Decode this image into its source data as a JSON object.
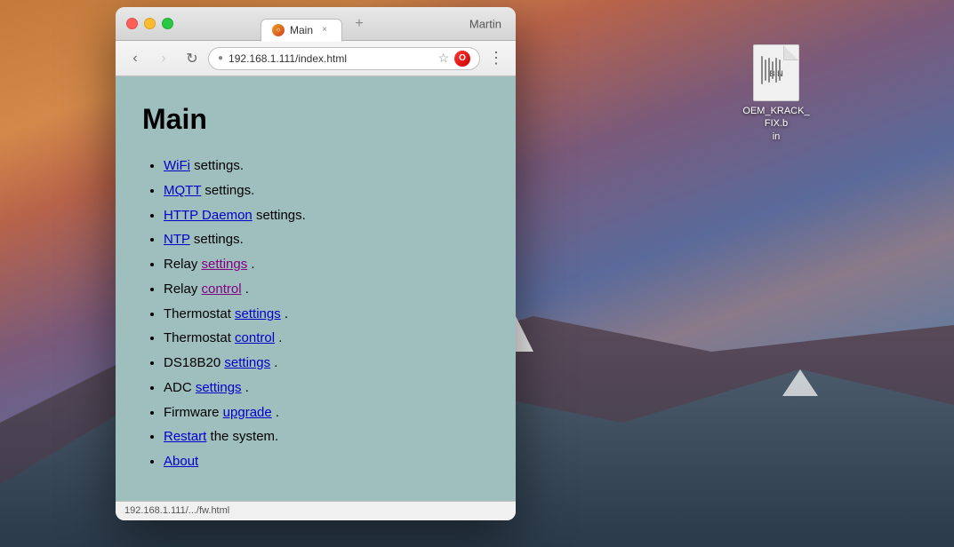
{
  "desktop": {
    "background_description": "macOS desktop with mountain sunset",
    "file_icon": {
      "name": "OEM_KRACK_FIX.b",
      "subtitle": "in",
      "label": "BIN"
    }
  },
  "browser": {
    "title_bar": {
      "tab_title": "Main",
      "tab_favicon": "○",
      "user_name": "Martin",
      "close_label": "×",
      "new_tab_label": "+"
    },
    "nav_bar": {
      "back_label": "‹",
      "forward_label": "›",
      "reload_label": "↻",
      "address": "192.168.1.111/index.html",
      "star_label": "★",
      "more_label": "⋮"
    },
    "page": {
      "title": "Main",
      "menu_items": [
        {
          "link": "WiFi",
          "suffix": " settings."
        },
        {
          "link": "MQTT",
          "suffix": " settings."
        },
        {
          "link": "HTTP Daemon",
          "suffix": " settings."
        },
        {
          "link": "NTP",
          "suffix": " settings."
        },
        {
          "prefix": "Relay ",
          "link": "settings",
          "suffix": "."
        },
        {
          "prefix": "Relay ",
          "link": "control",
          "suffix": "."
        },
        {
          "prefix": "Thermostat ",
          "link": "settings",
          "suffix": "."
        },
        {
          "prefix": "Thermostat ",
          "link": "control",
          "suffix": "."
        },
        {
          "prefix": "DS18B20 ",
          "link": "settings",
          "suffix": "."
        },
        {
          "prefix": "ADC ",
          "link": "settings",
          "suffix": "."
        },
        {
          "prefix": "Firmware ",
          "link": "upgrade",
          "suffix": "."
        },
        {
          "link": "Restart",
          "suffix": " the system."
        },
        {
          "link": "About",
          "suffix": ""
        }
      ]
    },
    "status_bar": {
      "text": "192.168.1.111/.../fw.html"
    }
  }
}
